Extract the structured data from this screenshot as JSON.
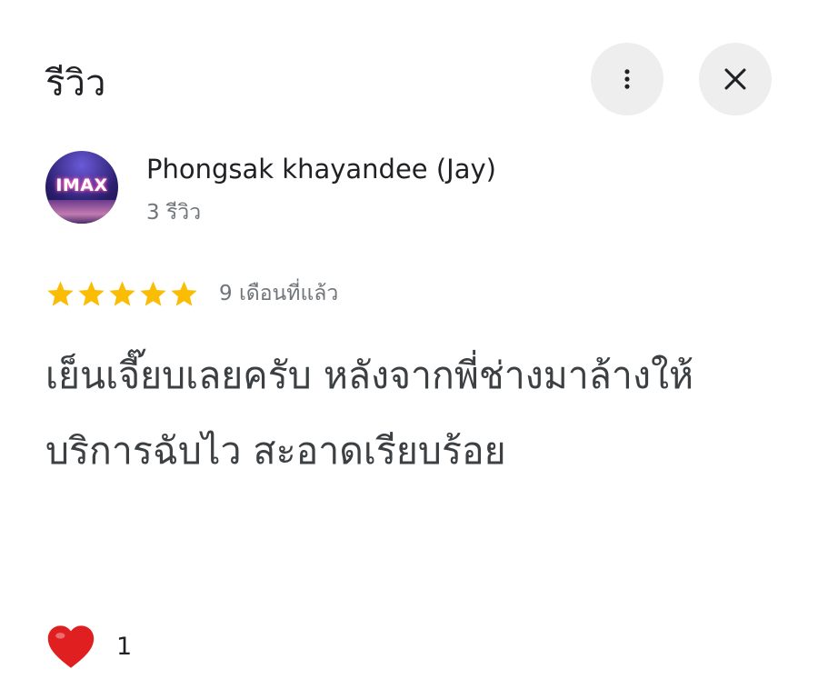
{
  "header": {
    "title": "รีวิว",
    "more_icon": "more-vert-icon",
    "close_icon": "close-icon"
  },
  "reviewer": {
    "name": "Phongsak khayandee (Jay)",
    "review_count": "3 รีวิว",
    "avatar_text": "IMAX"
  },
  "review": {
    "rating": 5,
    "max_rating": 5,
    "star_color": "#fbbc04",
    "time_ago": "9 เดือนที่แล้ว",
    "text": "เย็นเจี๊ยบเลยครับ หลังจากพี่ช่างมาล้างให้ บริการฉับไว สะอาดเรียบร้อย"
  },
  "reaction": {
    "icon": "heart-icon",
    "color": "#e02020",
    "count": "1"
  }
}
